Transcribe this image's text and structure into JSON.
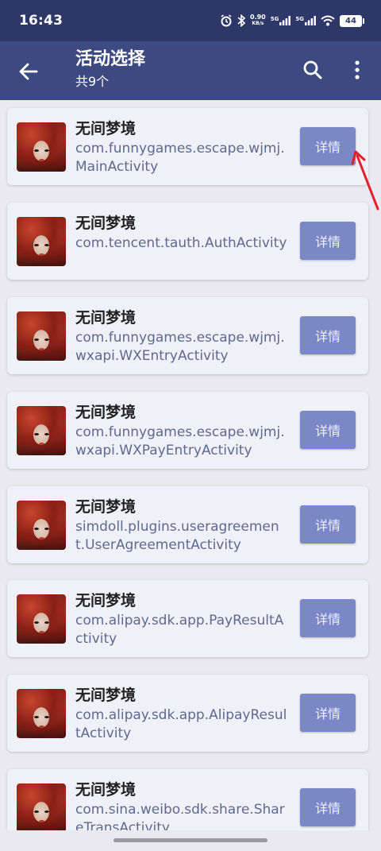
{
  "status": {
    "time": "16:43",
    "net_speed_value": "0.90",
    "net_speed_unit": "KB/s",
    "sim1": "5G",
    "sim2": "5G",
    "battery": "44"
  },
  "appbar": {
    "title": "活动选择",
    "subtitle": "共9个"
  },
  "items": [
    {
      "app": "无间梦境",
      "activity": "com.funnygames.escape.wjmj.MainActivity",
      "button": "详情"
    },
    {
      "app": "无间梦境",
      "activity": "com.tencent.tauth.AuthActivity",
      "button": "详情"
    },
    {
      "app": "无间梦境",
      "activity": "com.funnygames.escape.wjmj.wxapi.WXEntryActivity",
      "button": "详情"
    },
    {
      "app": "无间梦境",
      "activity": "com.funnygames.escape.wjmj.wxapi.WXPayEntryActivity",
      "button": "详情"
    },
    {
      "app": "无间梦境",
      "activity": "simdoll.plugins.useragreement.UserAgreementActivity",
      "button": "详情"
    },
    {
      "app": "无间梦境",
      "activity": "com.alipay.sdk.app.PayResultActivity",
      "button": "详情"
    },
    {
      "app": "无间梦境",
      "activity": "com.alipay.sdk.app.AlipayResultActivity",
      "button": "详情"
    },
    {
      "app": "无间梦境",
      "activity": "com.sina.weibo.sdk.share.ShareTransActivity",
      "button": "详情"
    }
  ],
  "colors": {
    "statusbar": "#2d3868",
    "appbar": "#3d4a82",
    "button": "#7b88c8",
    "card": "#f0f0f8",
    "annotation_arrow": "#e0202a"
  },
  "icons": {
    "back": "arrow-left-icon",
    "search": "search-icon",
    "more": "more-vertical-icon",
    "alarm": "alarm-icon",
    "bluetooth": "bluetooth-icon",
    "wifi": "wifi-icon"
  }
}
